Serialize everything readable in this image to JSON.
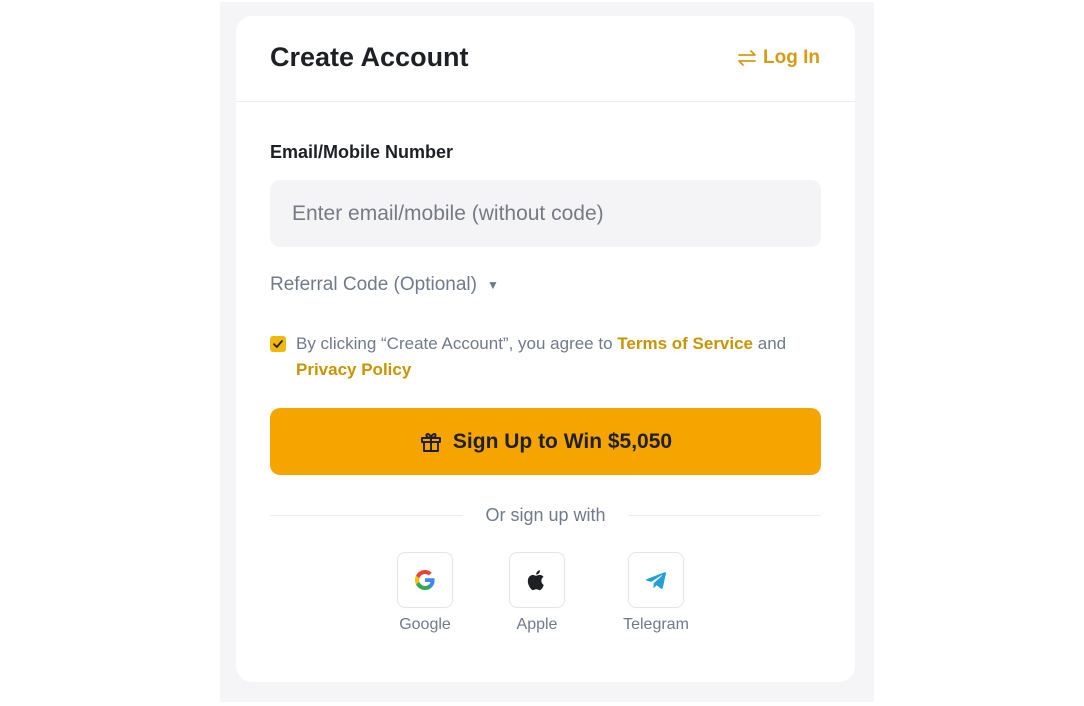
{
  "header": {
    "title": "Create Account",
    "login_label": "Log In"
  },
  "form": {
    "email_label": "Email/Mobile Number",
    "email_placeholder": "Enter email/mobile (without code)",
    "email_value": "",
    "referral_label": "Referral Code (Optional)",
    "terms": {
      "checked": true,
      "prefix": "By clicking “Create Account”, you agree to ",
      "tos_link": "Terms of Service",
      "conjunction": " and ",
      "privacy_link": "Privacy Policy"
    },
    "submit_label": "Sign Up to Win $5,050"
  },
  "social": {
    "divider_text": "Or sign up with",
    "providers": [
      {
        "label": "Google",
        "icon": "google-icon"
      },
      {
        "label": "Apple",
        "icon": "apple-icon"
      },
      {
        "label": "Telegram",
        "icon": "telegram-icon"
      }
    ]
  },
  "colors": {
    "accent": "#f6a500",
    "link": "#c99400",
    "checkbox": "#f0b90b"
  }
}
